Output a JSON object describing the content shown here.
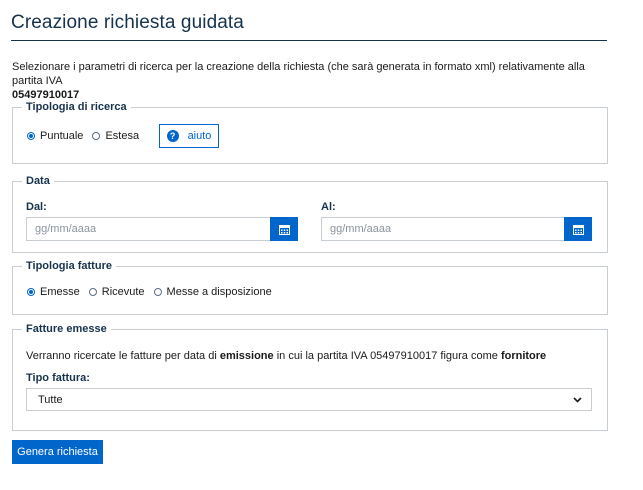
{
  "page": {
    "title": "Creazione richiesta guidata",
    "intro_text": "Selezionare i parametri di ricerca per la creazione della richiesta (che sarà generata in formato xml) relativamente alla partita IVA",
    "vat_number": "05497910017"
  },
  "search_type": {
    "legend": "Tipologia di ricerca",
    "options": [
      {
        "label": "Puntuale",
        "selected": true
      },
      {
        "label": "Estesa",
        "selected": false
      }
    ],
    "help_label": "aiuto",
    "help_icon": "question-circle-icon"
  },
  "date": {
    "legend": "Data",
    "from_label": "Dal:",
    "from_placeholder": "gg/mm/aaaa",
    "from_value": "",
    "to_label": "Al:",
    "to_placeholder": "gg/mm/aaaa",
    "to_value": "",
    "calendar_icon": "calendar-icon"
  },
  "invoice_type": {
    "legend": "Tipologia fatture",
    "options": [
      {
        "label": "Emesse",
        "selected": true
      },
      {
        "label": "Ricevute",
        "selected": false
      },
      {
        "label": "Messe a disposizione",
        "selected": false
      }
    ]
  },
  "issued_invoices": {
    "legend": "Fatture emesse",
    "desc_prefix": "Verranno ricercate le fatture per data di",
    "desc_bold1": "emissione",
    "desc_middle": "in cui la partita IVA 05497910017 figura come",
    "desc_bold2": "fornitore",
    "select_label": "Tipo fattura:",
    "select_value": "Tutte"
  },
  "actions": {
    "submit_label": "Genera richiesta"
  },
  "colors": {
    "primary": "#0066cc",
    "heading": "#17324d",
    "border": "#c7cdd3"
  }
}
